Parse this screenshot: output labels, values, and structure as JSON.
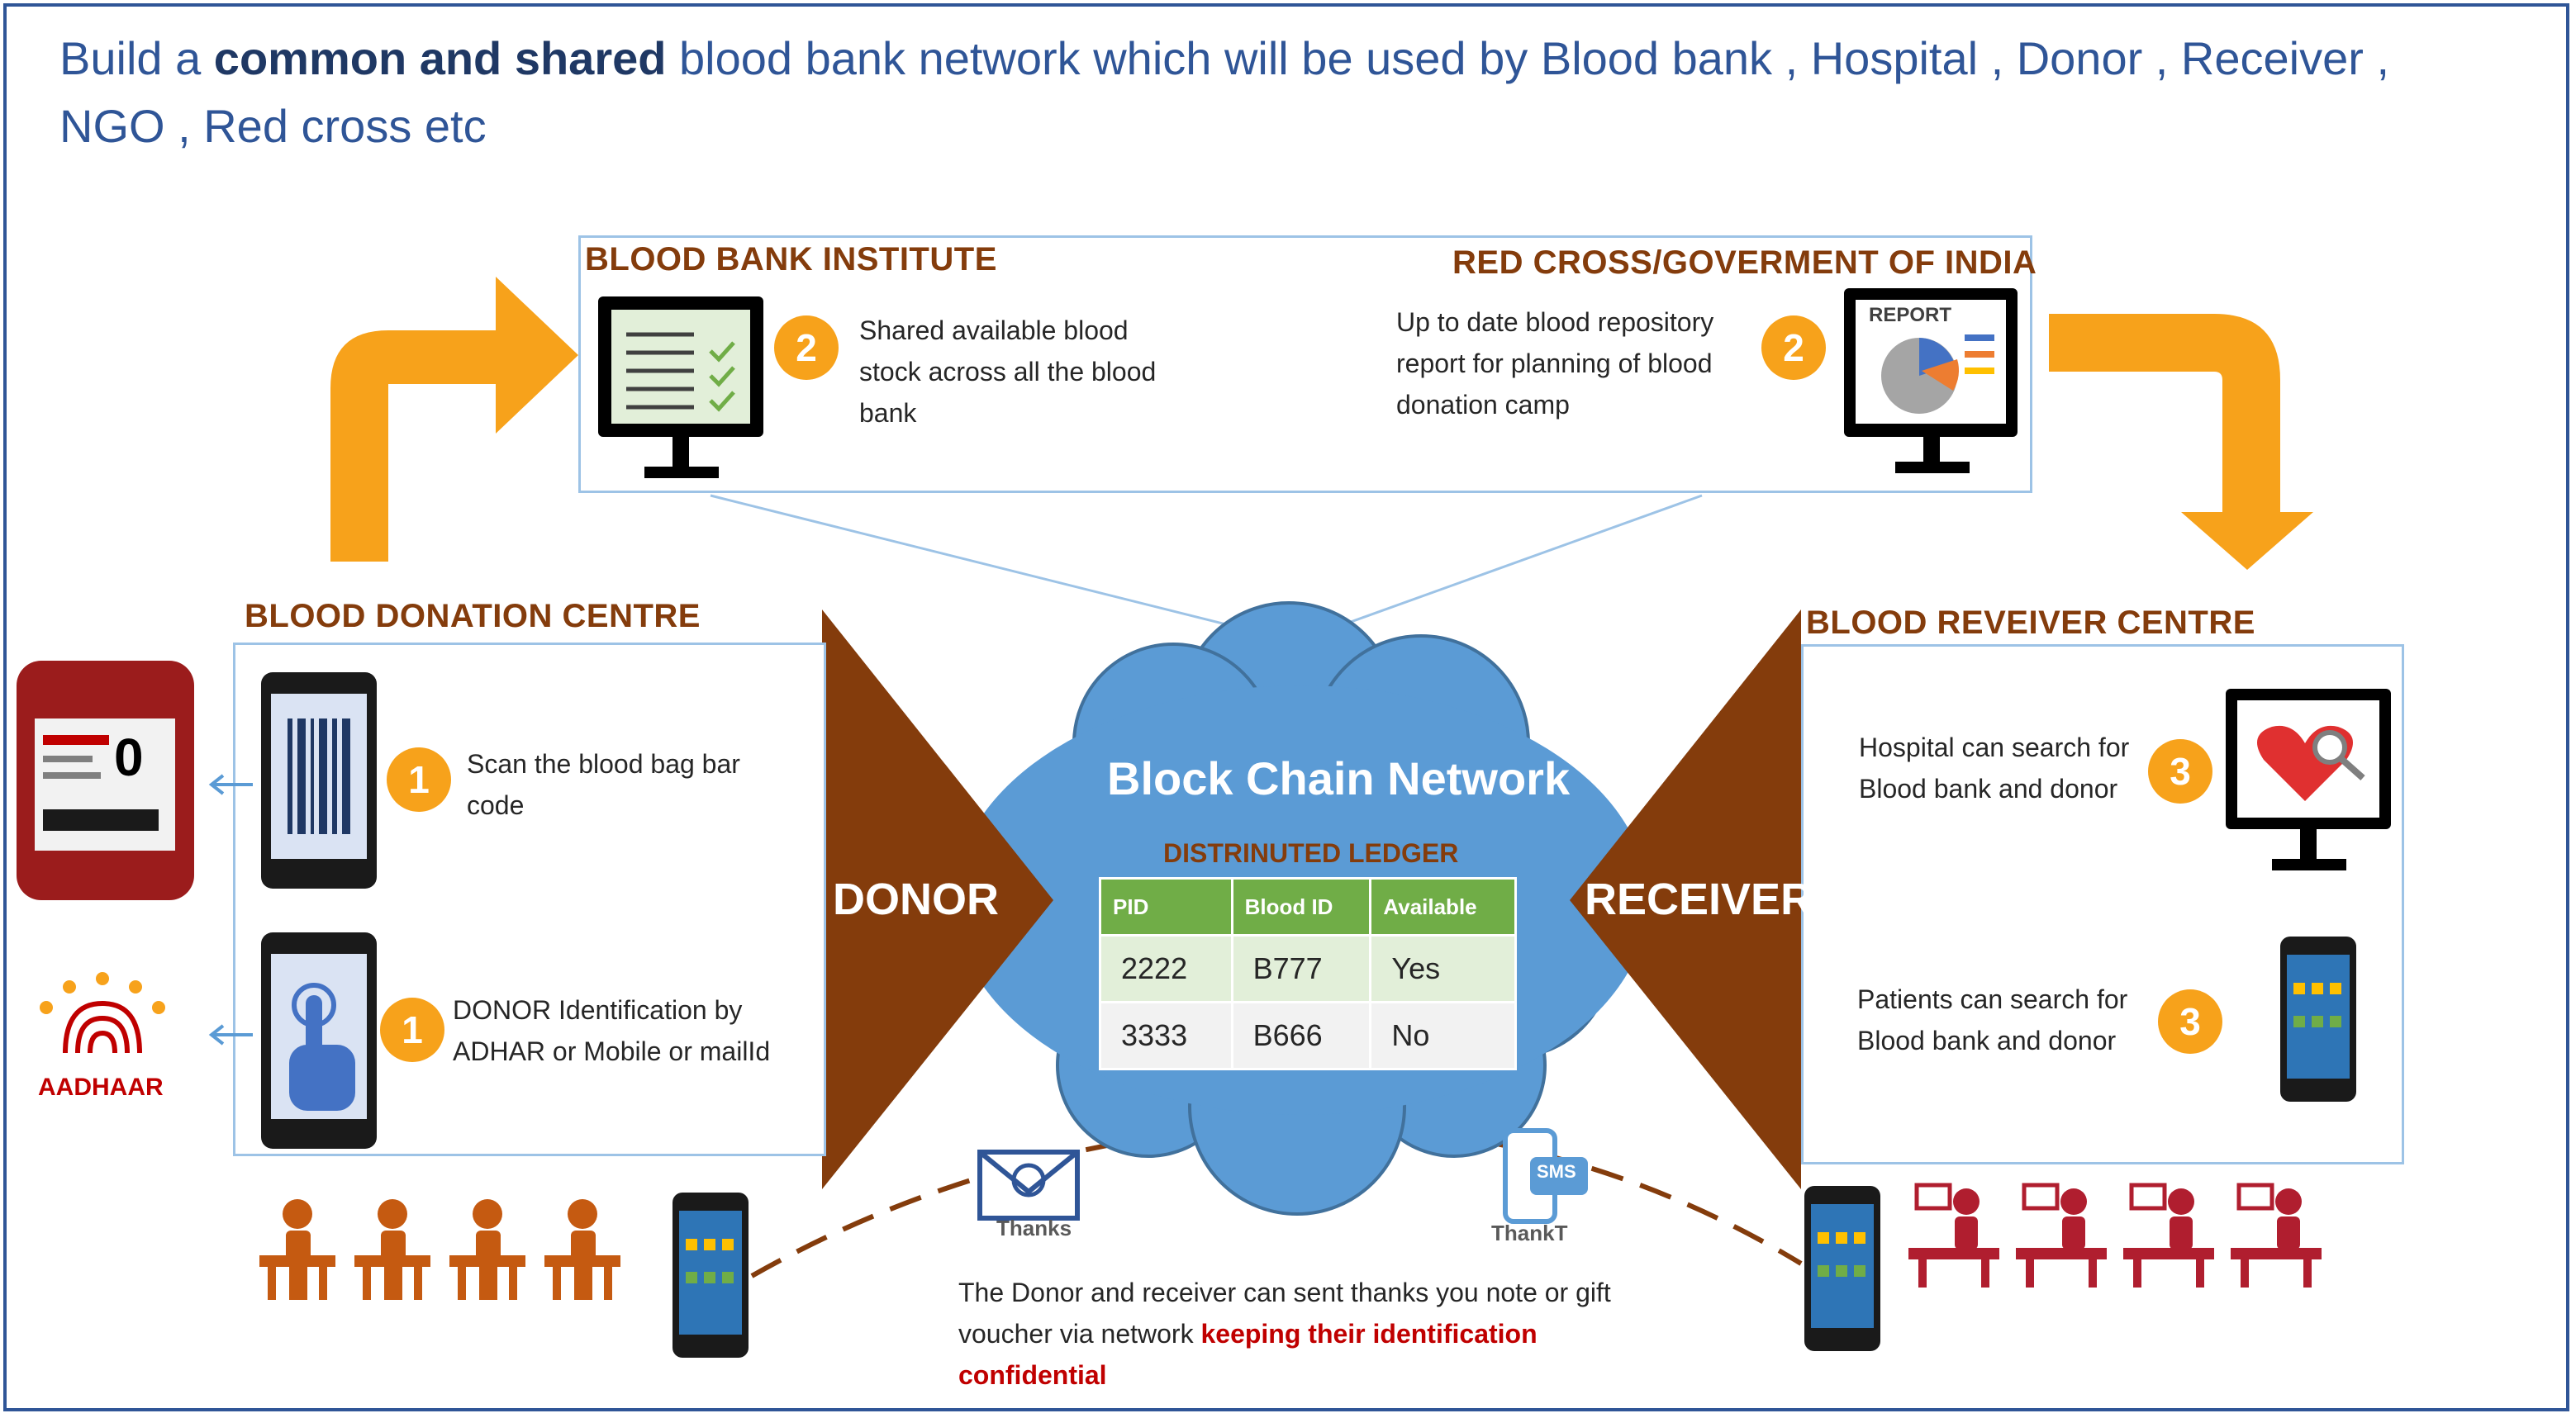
{
  "heading": {
    "part1": "Build a ",
    "bold": "common and shared",
    "part2": " blood bank network which will be used by Blood bank , Hospital , Donor , Receiver , NGO , Red cross etc"
  },
  "blood_bank_institute": {
    "title": "BLOOD BANK INSTITUTE",
    "step": "2",
    "text": "Shared available blood stock across all the blood bank"
  },
  "red_cross": {
    "title": "RED CROSS/GOVERMENT OF INDIA",
    "step": "2",
    "text": "Up to date blood repository report for planning of blood donation camp",
    "screen_label": "REPORT"
  },
  "donation_centre": {
    "title": "BLOOD DONATION CENTRE",
    "items": [
      {
        "step": "1",
        "text": "Scan the blood bag bar code"
      },
      {
        "step": "1",
        "text": "DONOR Identification by ADHAR or Mobile or mailId"
      }
    ],
    "aadhaar_label": "AADHAAR",
    "blood_bag_label": "0"
  },
  "receiver_centre": {
    "title": "BLOOD REVEIVER CENTRE",
    "items": [
      {
        "step": "3",
        "text": "Hospital can search for Blood bank and donor"
      },
      {
        "step": "3",
        "text": "Patients can search for Blood bank and donor"
      }
    ]
  },
  "donor_label": "DONOR",
  "receiver_label": "RECEIVER",
  "network": {
    "title": "Block Chain Network",
    "ledger_title": "DISTRINUTED LEDGER",
    "headers": [
      "PID",
      "Blood ID",
      "Available"
    ],
    "rows": [
      [
        "2222",
        "B777",
        "Yes"
      ],
      [
        "3333",
        "B666",
        "No"
      ]
    ]
  },
  "thanks": {
    "email_label": "Thanks",
    "sms_badge": "SMS",
    "sms_label": "ThankT"
  },
  "footer": {
    "text": "The Donor and receiver can sent thanks you note or gift voucher via network ",
    "highlight": "keeping their identification confidential"
  },
  "colors": {
    "accent_orange": "#f7a21b",
    "brown": "#843c0c",
    "cloud_blue": "#5b9bd5",
    "ledger_green": "#70ad47",
    "box_border": "#9dc3e6",
    "heading_blue": "#2f5597",
    "receiver_red": "#b01e2f"
  }
}
